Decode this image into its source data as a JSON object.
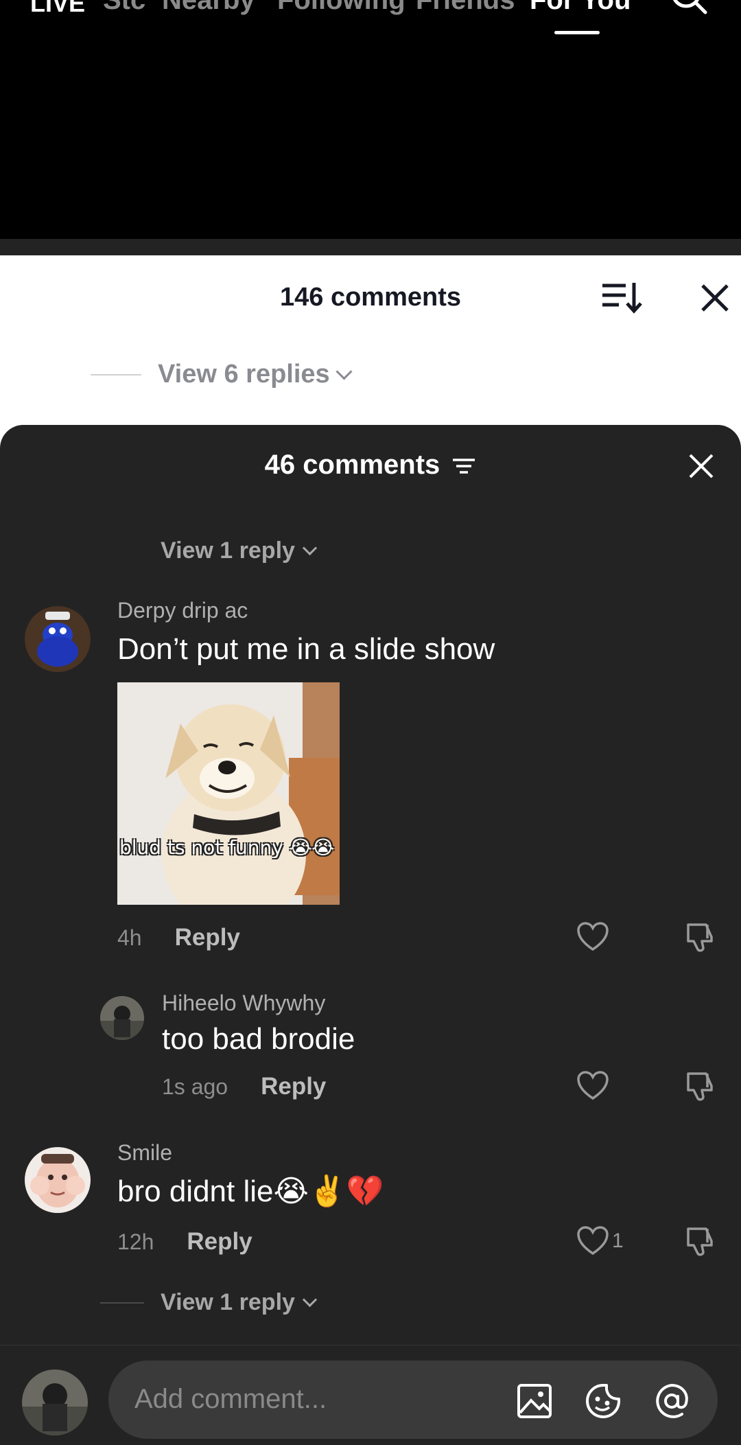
{
  "top_nav": {
    "live_label": "LIVE",
    "tabs": [
      "Nearby",
      "Following",
      "Friends",
      "For You"
    ],
    "partial_tab": "Stc",
    "active_tab": "For You"
  },
  "white_sheet": {
    "title": "146 comments",
    "view_replies": "View 6 replies"
  },
  "dark_sheet": {
    "title": "46 comments",
    "top_view_reply": "View 1 reply",
    "comments": [
      {
        "username": "Derpy drip ac",
        "text": "Don’t put me in a slide show",
        "gif_caption": "blud ts not funny 😭😭",
        "time": "4h",
        "reply_label": "Reply"
      },
      {
        "username": "Hiheelo Whywhy",
        "text": "too bad brodie",
        "time": "1s ago",
        "reply_label": "Reply"
      },
      {
        "username": "Smile",
        "text": "bro didnt lie😭✌️💔",
        "time": "12h",
        "reply_label": "Reply",
        "like_count": "1"
      }
    ],
    "bottom_view_reply": "View 1 reply"
  },
  "input": {
    "placeholder": "Add comment..."
  }
}
